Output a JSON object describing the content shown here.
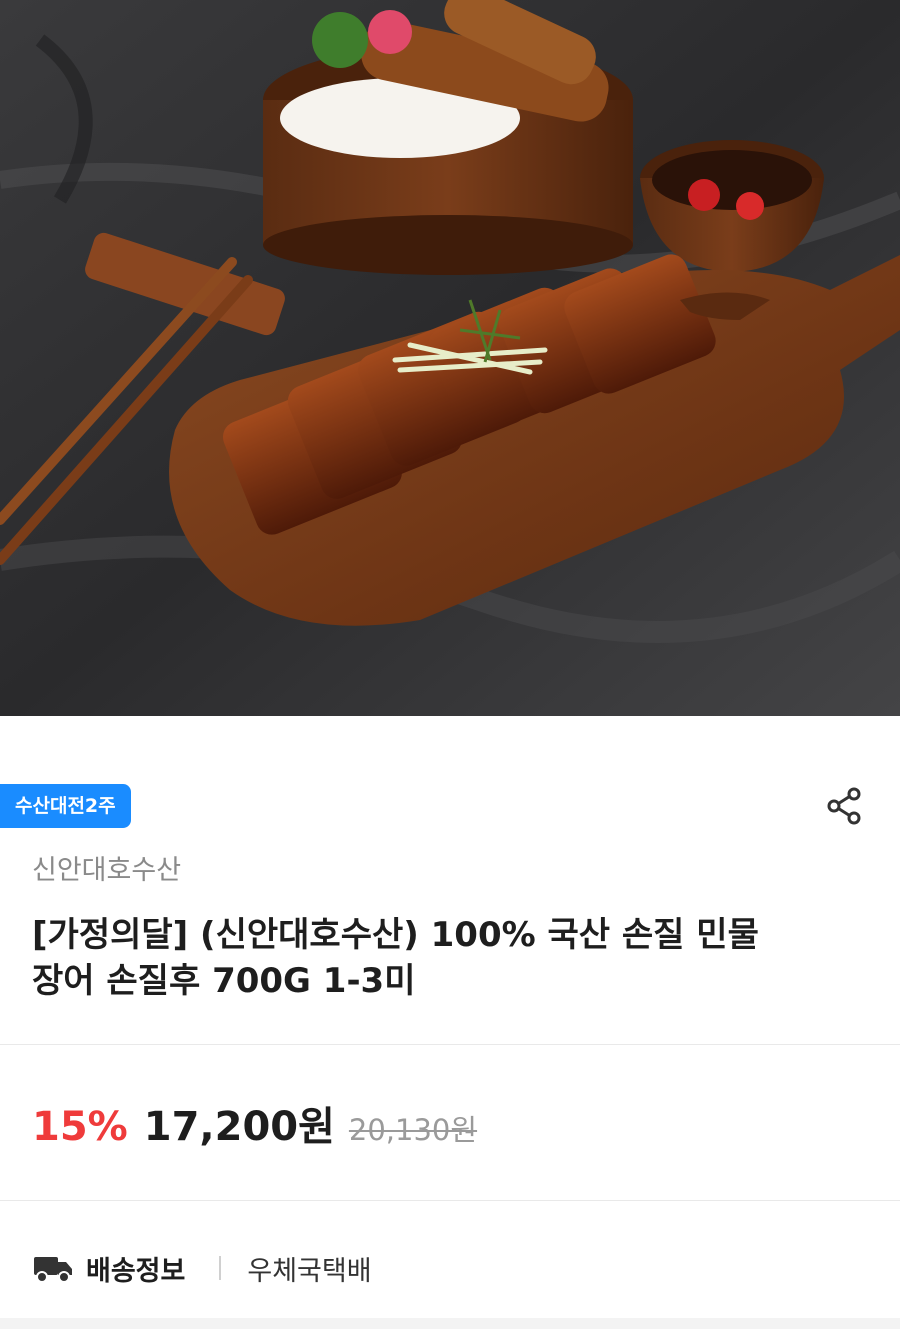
{
  "product": {
    "image_alt": "grilled eel on wooden board",
    "badge": "수산대전2주",
    "seller": "신안대호수산",
    "title": "[가정의달] (신안대호수산) 100% 국산 손질 민물장어 손질후 700G 1-3미"
  },
  "price": {
    "discount": "15%",
    "sale": "17,200원",
    "original": "20,130원"
  },
  "shipping": {
    "label": "배송정보",
    "value": "우체국택배"
  },
  "colors": {
    "badge": "#1a8cff",
    "discount": "#ef3b3b"
  },
  "icons": {
    "share": "share-icon",
    "delivery": "truck-icon"
  }
}
